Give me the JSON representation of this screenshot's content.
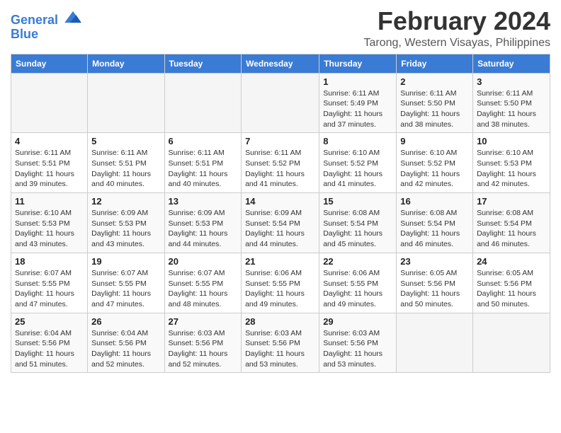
{
  "logo": {
    "line1": "General",
    "line2": "Blue"
  },
  "title": "February 2024",
  "subtitle": "Tarong, Western Visayas, Philippines",
  "days_header": [
    "Sunday",
    "Monday",
    "Tuesday",
    "Wednesday",
    "Thursday",
    "Friday",
    "Saturday"
  ],
  "weeks": [
    [
      {
        "day": "",
        "sunrise": "",
        "sunset": "",
        "daylight": ""
      },
      {
        "day": "",
        "sunrise": "",
        "sunset": "",
        "daylight": ""
      },
      {
        "day": "",
        "sunrise": "",
        "sunset": "",
        "daylight": ""
      },
      {
        "day": "",
        "sunrise": "",
        "sunset": "",
        "daylight": ""
      },
      {
        "day": "1",
        "sunrise": "6:11 AM",
        "sunset": "5:49 PM",
        "daylight": "11 hours and 37 minutes."
      },
      {
        "day": "2",
        "sunrise": "6:11 AM",
        "sunset": "5:50 PM",
        "daylight": "11 hours and 38 minutes."
      },
      {
        "day": "3",
        "sunrise": "6:11 AM",
        "sunset": "5:50 PM",
        "daylight": "11 hours and 38 minutes."
      }
    ],
    [
      {
        "day": "4",
        "sunrise": "6:11 AM",
        "sunset": "5:51 PM",
        "daylight": "11 hours and 39 minutes."
      },
      {
        "day": "5",
        "sunrise": "6:11 AM",
        "sunset": "5:51 PM",
        "daylight": "11 hours and 40 minutes."
      },
      {
        "day": "6",
        "sunrise": "6:11 AM",
        "sunset": "5:51 PM",
        "daylight": "11 hours and 40 minutes."
      },
      {
        "day": "7",
        "sunrise": "6:11 AM",
        "sunset": "5:52 PM",
        "daylight": "11 hours and 41 minutes."
      },
      {
        "day": "8",
        "sunrise": "6:10 AM",
        "sunset": "5:52 PM",
        "daylight": "11 hours and 41 minutes."
      },
      {
        "day": "9",
        "sunrise": "6:10 AM",
        "sunset": "5:52 PM",
        "daylight": "11 hours and 42 minutes."
      },
      {
        "day": "10",
        "sunrise": "6:10 AM",
        "sunset": "5:53 PM",
        "daylight": "11 hours and 42 minutes."
      }
    ],
    [
      {
        "day": "11",
        "sunrise": "6:10 AM",
        "sunset": "5:53 PM",
        "daylight": "11 hours and 43 minutes."
      },
      {
        "day": "12",
        "sunrise": "6:09 AM",
        "sunset": "5:53 PM",
        "daylight": "11 hours and 43 minutes."
      },
      {
        "day": "13",
        "sunrise": "6:09 AM",
        "sunset": "5:53 PM",
        "daylight": "11 hours and 44 minutes."
      },
      {
        "day": "14",
        "sunrise": "6:09 AM",
        "sunset": "5:54 PM",
        "daylight": "11 hours and 44 minutes."
      },
      {
        "day": "15",
        "sunrise": "6:08 AM",
        "sunset": "5:54 PM",
        "daylight": "11 hours and 45 minutes."
      },
      {
        "day": "16",
        "sunrise": "6:08 AM",
        "sunset": "5:54 PM",
        "daylight": "11 hours and 46 minutes."
      },
      {
        "day": "17",
        "sunrise": "6:08 AM",
        "sunset": "5:54 PM",
        "daylight": "11 hours and 46 minutes."
      }
    ],
    [
      {
        "day": "18",
        "sunrise": "6:07 AM",
        "sunset": "5:55 PM",
        "daylight": "11 hours and 47 minutes."
      },
      {
        "day": "19",
        "sunrise": "6:07 AM",
        "sunset": "5:55 PM",
        "daylight": "11 hours and 47 minutes."
      },
      {
        "day": "20",
        "sunrise": "6:07 AM",
        "sunset": "5:55 PM",
        "daylight": "11 hours and 48 minutes."
      },
      {
        "day": "21",
        "sunrise": "6:06 AM",
        "sunset": "5:55 PM",
        "daylight": "11 hours and 49 minutes."
      },
      {
        "day": "22",
        "sunrise": "6:06 AM",
        "sunset": "5:55 PM",
        "daylight": "11 hours and 49 minutes."
      },
      {
        "day": "23",
        "sunrise": "6:05 AM",
        "sunset": "5:56 PM",
        "daylight": "11 hours and 50 minutes."
      },
      {
        "day": "24",
        "sunrise": "6:05 AM",
        "sunset": "5:56 PM",
        "daylight": "11 hours and 50 minutes."
      }
    ],
    [
      {
        "day": "25",
        "sunrise": "6:04 AM",
        "sunset": "5:56 PM",
        "daylight": "11 hours and 51 minutes."
      },
      {
        "day": "26",
        "sunrise": "6:04 AM",
        "sunset": "5:56 PM",
        "daylight": "11 hours and 52 minutes."
      },
      {
        "day": "27",
        "sunrise": "6:03 AM",
        "sunset": "5:56 PM",
        "daylight": "11 hours and 52 minutes."
      },
      {
        "day": "28",
        "sunrise": "6:03 AM",
        "sunset": "5:56 PM",
        "daylight": "11 hours and 53 minutes."
      },
      {
        "day": "29",
        "sunrise": "6:03 AM",
        "sunset": "5:56 PM",
        "daylight": "11 hours and 53 minutes."
      },
      {
        "day": "",
        "sunrise": "",
        "sunset": "",
        "daylight": ""
      },
      {
        "day": "",
        "sunrise": "",
        "sunset": "",
        "daylight": ""
      }
    ]
  ]
}
